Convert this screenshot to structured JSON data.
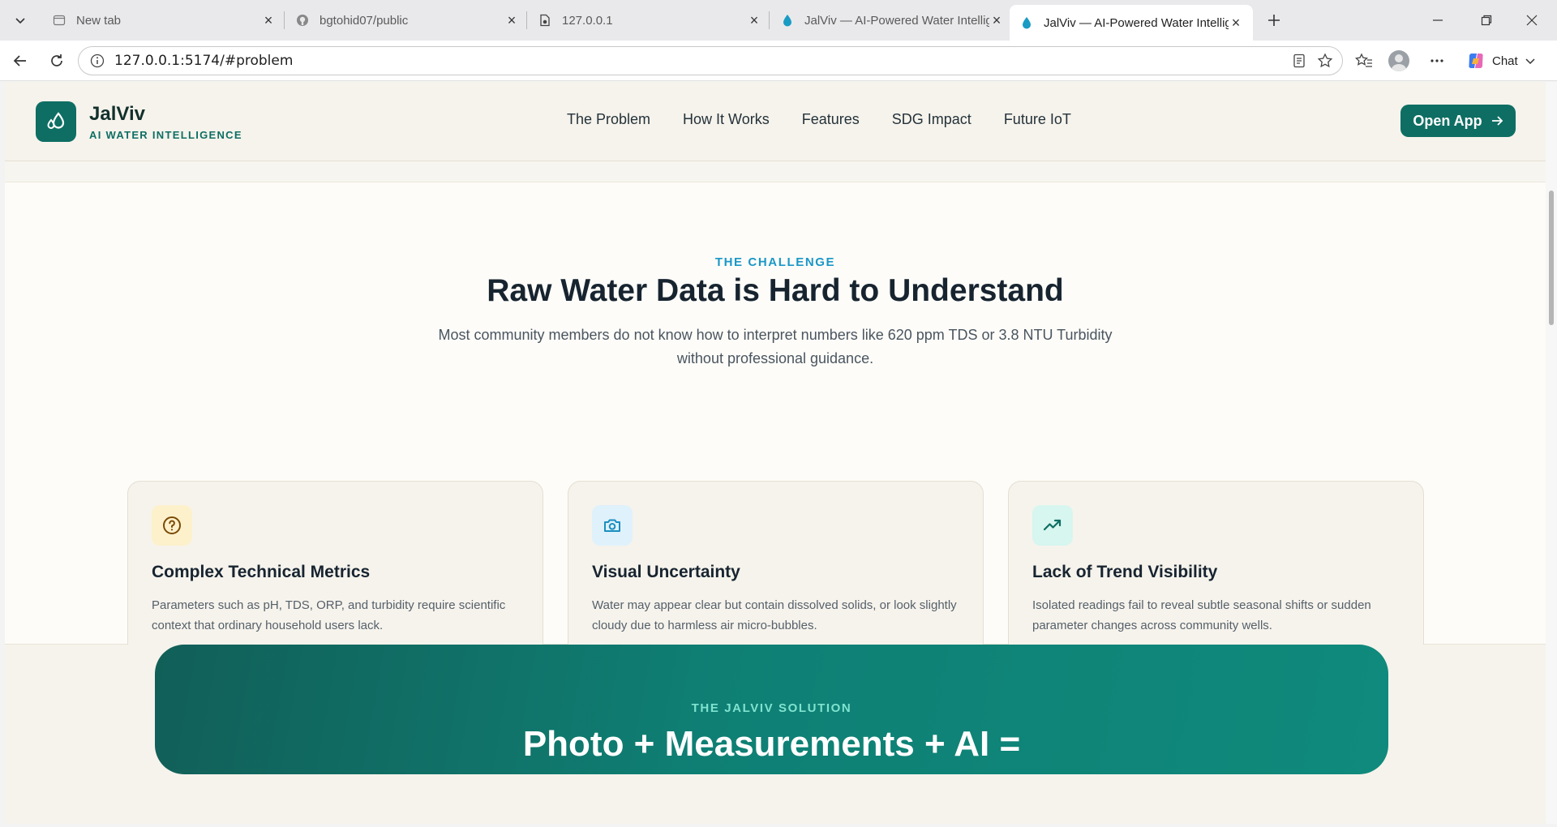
{
  "browser": {
    "tabs": [
      {
        "title": "New tab",
        "active": false
      },
      {
        "title": "bgtohid07/public",
        "active": false
      },
      {
        "title": "127.0.0.1",
        "active": false
      },
      {
        "title": "JalViv — AI-Powered Water Intellig",
        "active": false
      },
      {
        "title": "JalViv — AI-Powered Water Intellig",
        "active": true
      }
    ],
    "url": "127.0.0.1:5174/#problem",
    "chat_label": "Chat"
  },
  "header": {
    "brand_name": "JalViv",
    "brand_tagline": "AI WATER INTELLIGENCE",
    "nav": [
      "The Problem",
      "How It Works",
      "Features",
      "SDG Impact",
      "Future IoT"
    ],
    "cta_label": "Open App"
  },
  "problem": {
    "eyebrow": "THE CHALLENGE",
    "title": "Raw Water Data is Hard to Understand",
    "lead": "Most community members do not know how to interpret numbers like 620 ppm TDS or 3.8 NTU Turbidity without professional guidance.",
    "cards": [
      {
        "icon": "question-circle-icon",
        "title": "Complex Technical Metrics",
        "body": "Parameters such as pH, TDS, ORP, and turbidity require scientific context that ordinary household users lack.",
        "accent": "#fdf1cc"
      },
      {
        "icon": "camera-icon",
        "title": "Visual Uncertainty",
        "body": "Water may appear clear but contain dissolved solids, or look slightly cloudy due to harmless air micro-bubbles.",
        "accent": "#dff1fb"
      },
      {
        "icon": "trending-up-icon",
        "title": "Lack of Trend Visibility",
        "body": "Isolated readings fail to reveal subtle seasonal shifts or sudden parameter changes across community wells.",
        "accent": "#d6f6ef"
      }
    ]
  },
  "solution": {
    "eyebrow": "THE JALVIV SOLUTION",
    "headline": "Photo + Measurements + AI ="
  },
  "colors": {
    "brand": "#0e6e63",
    "eyebrow_blue": "#1b97c7",
    "eyebrow_mint": "#7fe3cf"
  }
}
